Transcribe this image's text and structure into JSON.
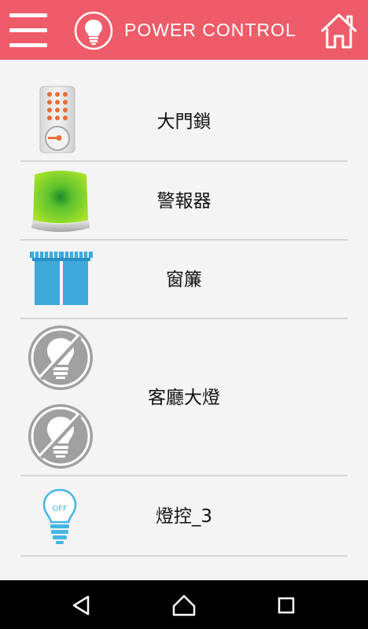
{
  "app": {
    "title": "POWER CONTROL"
  },
  "header_icons": {
    "menu": "hamburger-menu-icon",
    "logo": "lightbulb-icon",
    "home": "home-icon"
  },
  "devices": [
    {
      "label": "大門鎖",
      "icon": "door-lock-keypad-icon"
    },
    {
      "label": "警報器",
      "icon": "alarm-siren-icon"
    },
    {
      "label": "窗簾",
      "icon": "curtain-icon"
    },
    {
      "label": "客廳大燈",
      "icon": "light-bulb-disabled-icon"
    },
    {
      "label": "燈控_3",
      "icon": "light-bulb-off-icon",
      "state": "OFF"
    }
  ],
  "nav": {
    "back": "back-icon",
    "home": "home-nav-icon",
    "recents": "recents-icon"
  },
  "colors": {
    "header": "#ee5c6a",
    "background": "#f4f4f4",
    "navbar": "#000000",
    "bulb_off": "#45b5e4"
  }
}
